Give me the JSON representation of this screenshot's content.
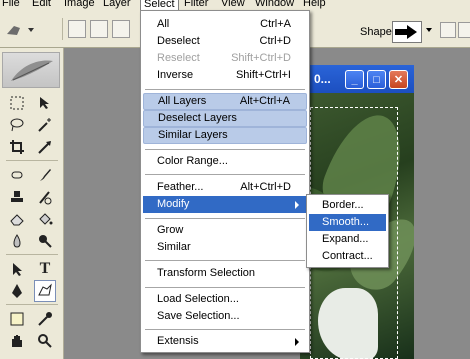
{
  "menubar": {
    "items": [
      {
        "label": "File"
      },
      {
        "label": "Edit"
      },
      {
        "label": "Image"
      },
      {
        "label": "Layer"
      },
      {
        "label": "Select"
      },
      {
        "label": "Filter"
      },
      {
        "label": "View"
      },
      {
        "label": "Window"
      },
      {
        "label": "Help"
      }
    ]
  },
  "options_bar": {
    "shape_label": "Shape:"
  },
  "document": {
    "title": "0..."
  },
  "select_menu": {
    "items": [
      {
        "label": "All",
        "shortcut": "Ctrl+A"
      },
      {
        "label": "Deselect",
        "shortcut": "Ctrl+D"
      },
      {
        "label": "Reselect",
        "shortcut": "Shift+Ctrl+D"
      },
      {
        "label": "Inverse",
        "shortcut": "Shift+Ctrl+I"
      },
      {
        "label": "All Layers",
        "shortcut": "Alt+Ctrl+A"
      },
      {
        "label": "Deselect Layers",
        "shortcut": ""
      },
      {
        "label": "Similar Layers",
        "shortcut": ""
      },
      {
        "label": "Color Range...",
        "shortcut": ""
      },
      {
        "label": "Feather...",
        "shortcut": "Alt+Ctrl+D"
      },
      {
        "label": "Modify",
        "shortcut": ""
      },
      {
        "label": "Grow",
        "shortcut": ""
      },
      {
        "label": "Similar",
        "shortcut": ""
      },
      {
        "label": "Transform Selection",
        "shortcut": ""
      },
      {
        "label": "Load Selection...",
        "shortcut": ""
      },
      {
        "label": "Save Selection...",
        "shortcut": ""
      },
      {
        "label": "Extensis",
        "shortcut": ""
      }
    ]
  },
  "modify_submenu": {
    "items": [
      {
        "label": "Border..."
      },
      {
        "label": "Smooth..."
      },
      {
        "label": "Expand..."
      },
      {
        "label": "Contract..."
      }
    ]
  },
  "colors": {
    "highlight": "#316ac5",
    "soft_highlight": "#b9cbe8",
    "titlebar": "#2a64d8"
  }
}
